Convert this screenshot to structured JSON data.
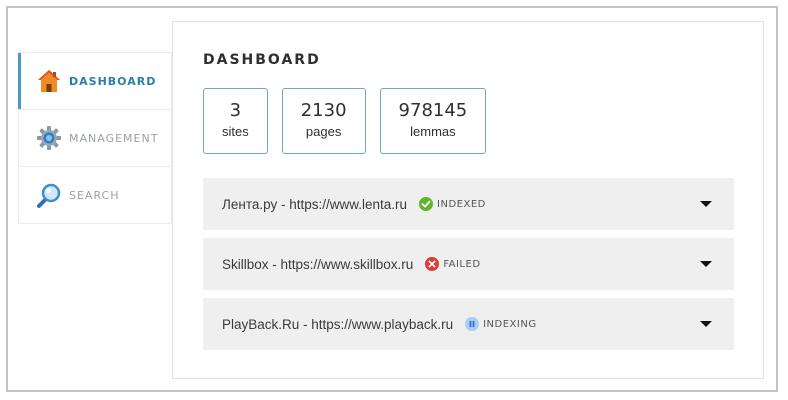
{
  "sidebar": {
    "items": [
      {
        "label": "DASHBOARD",
        "icon": "home-icon",
        "active": true
      },
      {
        "label": "MANAGEMENT",
        "icon": "gear-icon",
        "active": false
      },
      {
        "label": "SEARCH",
        "icon": "magnifier-icon",
        "active": false
      }
    ]
  },
  "main": {
    "title": "DASHBOARD",
    "stats": [
      {
        "value": "3",
        "label": "sites"
      },
      {
        "value": "2130",
        "label": "pages"
      },
      {
        "value": "978145",
        "label": "lemmas"
      }
    ],
    "sites": [
      {
        "name": "Лента.ру - https://www.lenta.ru",
        "status": "INDEXED",
        "status_icon": "check-circle-icon"
      },
      {
        "name": "Skillbox - https://www.skillbox.ru",
        "status": "FAILED",
        "status_icon": "error-circle-icon"
      },
      {
        "name": "PlayBack.Ru - https://www.playback.ru",
        "status": "INDEXING",
        "status_icon": "pause-circle-icon"
      }
    ]
  },
  "colors": {
    "accent": "#2b7ea9",
    "indexed": "#5cb82a",
    "failed": "#e03a3a",
    "indexing": "#5b9ee8"
  }
}
